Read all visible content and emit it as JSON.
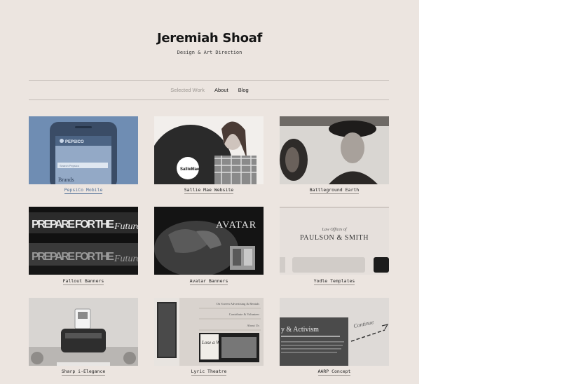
{
  "header": {
    "title": "Jeremiah Shoaf",
    "subtitle": "Design & Art Direction"
  },
  "nav": {
    "items": [
      {
        "label": "Selected Work",
        "active": true
      },
      {
        "label": "About",
        "active": false
      },
      {
        "label": "Blog",
        "active": false
      }
    ]
  },
  "colors": {
    "background": "#ece5e0",
    "active_nav": "#9c9792",
    "highlight_caption": "#4f6f96"
  },
  "projects": [
    {
      "caption": "PepsiCo Mobile",
      "highlighted": true,
      "image_text": [
        "PEPSICO",
        "Search Pepsico",
        "Brands"
      ]
    },
    {
      "caption": "Sallie Mae Website",
      "highlighted": false,
      "image_text": [
        "SallieMae"
      ]
    },
    {
      "caption": "Battleground Earth",
      "highlighted": false,
      "image_text": []
    },
    {
      "caption": "Fallout Banners",
      "highlighted": false,
      "image_text": [
        "PREPARE FOR THE",
        "Future"
      ]
    },
    {
      "caption": "Avatar Banners",
      "highlighted": false,
      "image_text": [
        "AVATAR"
      ]
    },
    {
      "caption": "Yodle Templates",
      "highlighted": false,
      "image_text": [
        "Law Offices of",
        "PAULSON & SMITH"
      ]
    },
    {
      "caption": "Sharp i-Elegance",
      "highlighted": false,
      "image_text": []
    },
    {
      "caption": "Lyric Theatre",
      "highlighted": false,
      "image_text": [
        "On Screen Advertising & Rentals",
        "Contribute & Volunteer",
        "About Us",
        "Lose a Wife"
      ]
    },
    {
      "caption": "AARP Concept",
      "highlighted": false,
      "image_text": [
        "y & Activism",
        "Continue"
      ]
    }
  ]
}
